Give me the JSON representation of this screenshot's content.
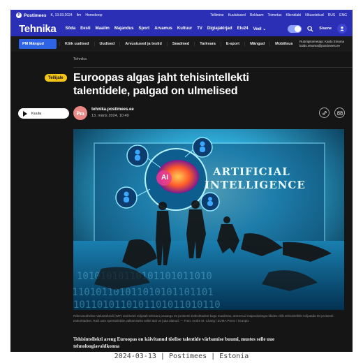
{
  "topbar": {
    "logo_mark": "P",
    "logo": "Postimees",
    "left_items": [
      "K, 13.03.2024",
      "Ilm",
      "Horoskoop"
    ],
    "right_items": [
      "Tellimine",
      "Kuulutused",
      "Reklaam",
      "Toimetus",
      "Kliendiabi",
      "Nõusolekud",
      "RUS",
      "ENG"
    ]
  },
  "header": {
    "brand": "Tehnika",
    "nav": [
      "Sõda",
      "Eesti",
      "Maailm",
      "Majandus",
      "Sport",
      "Arvamus",
      "Kultuur",
      "TV",
      "Digiajakirjad",
      "Elu24",
      "Veel ⌄"
    ],
    "search_icon": "search-icon",
    "user_label": "Sisene",
    "user_icon": "user-icon"
  },
  "subnav": {
    "pm_button": "PM Mängud",
    "items": [
      "Kõik uudised",
      "Uudised",
      "Arvustused ja testid",
      "Seadmed",
      "Tarkvara",
      "E-sport",
      "Mängud",
      "Mobiilsus"
    ],
    "contact_line1": "Rubriigitoimetaja: Kaido Einama",
    "contact_line2": "kaido.einama@postimees.ee"
  },
  "article": {
    "section": "Tehnika",
    "badge": "Tellijale",
    "headline": "Euroopas algas jaht tehisintellekti talentidele, palgad on ulmelised",
    "listen_label": "Kuula",
    "avatar_text": "Pm",
    "author": "tehnika.postimees.ee",
    "date": "13. märts 2024, 10:49",
    "hero_text_line1": "ARTIFICIAL",
    "hero_text_line2": "INTELLIGENCE",
    "hero_ai_label": "AI",
    "caption": "Rahvusvahelise Valuutafondi (IMF) andmetel mõjutab tehisaru peaaegu 40 protsenti töökohtadest kogu maailmas, arenenud majandustega riikides võib tehisintellekt mõjutada 60 protsenti töökohtadest. Raili uute spetsialistide palkamiseks sellel alal on juba alanud. — Foto: Andre M. Chang / ZUMA Press / Scanpix",
    "lead": "Tehisintellekti areng Euroopas on käivitanud tõelise talentide värbamise buumi, mustes selle uue tehnoloogiavaldkonna"
  },
  "footer": "2024-03-13 | Postimees | Estonia",
  "colors": {
    "brand_blue": "#2a2fb5",
    "pm_button": "#2f63e6",
    "badge_yellow": "#f5c518",
    "background": "#151515"
  }
}
